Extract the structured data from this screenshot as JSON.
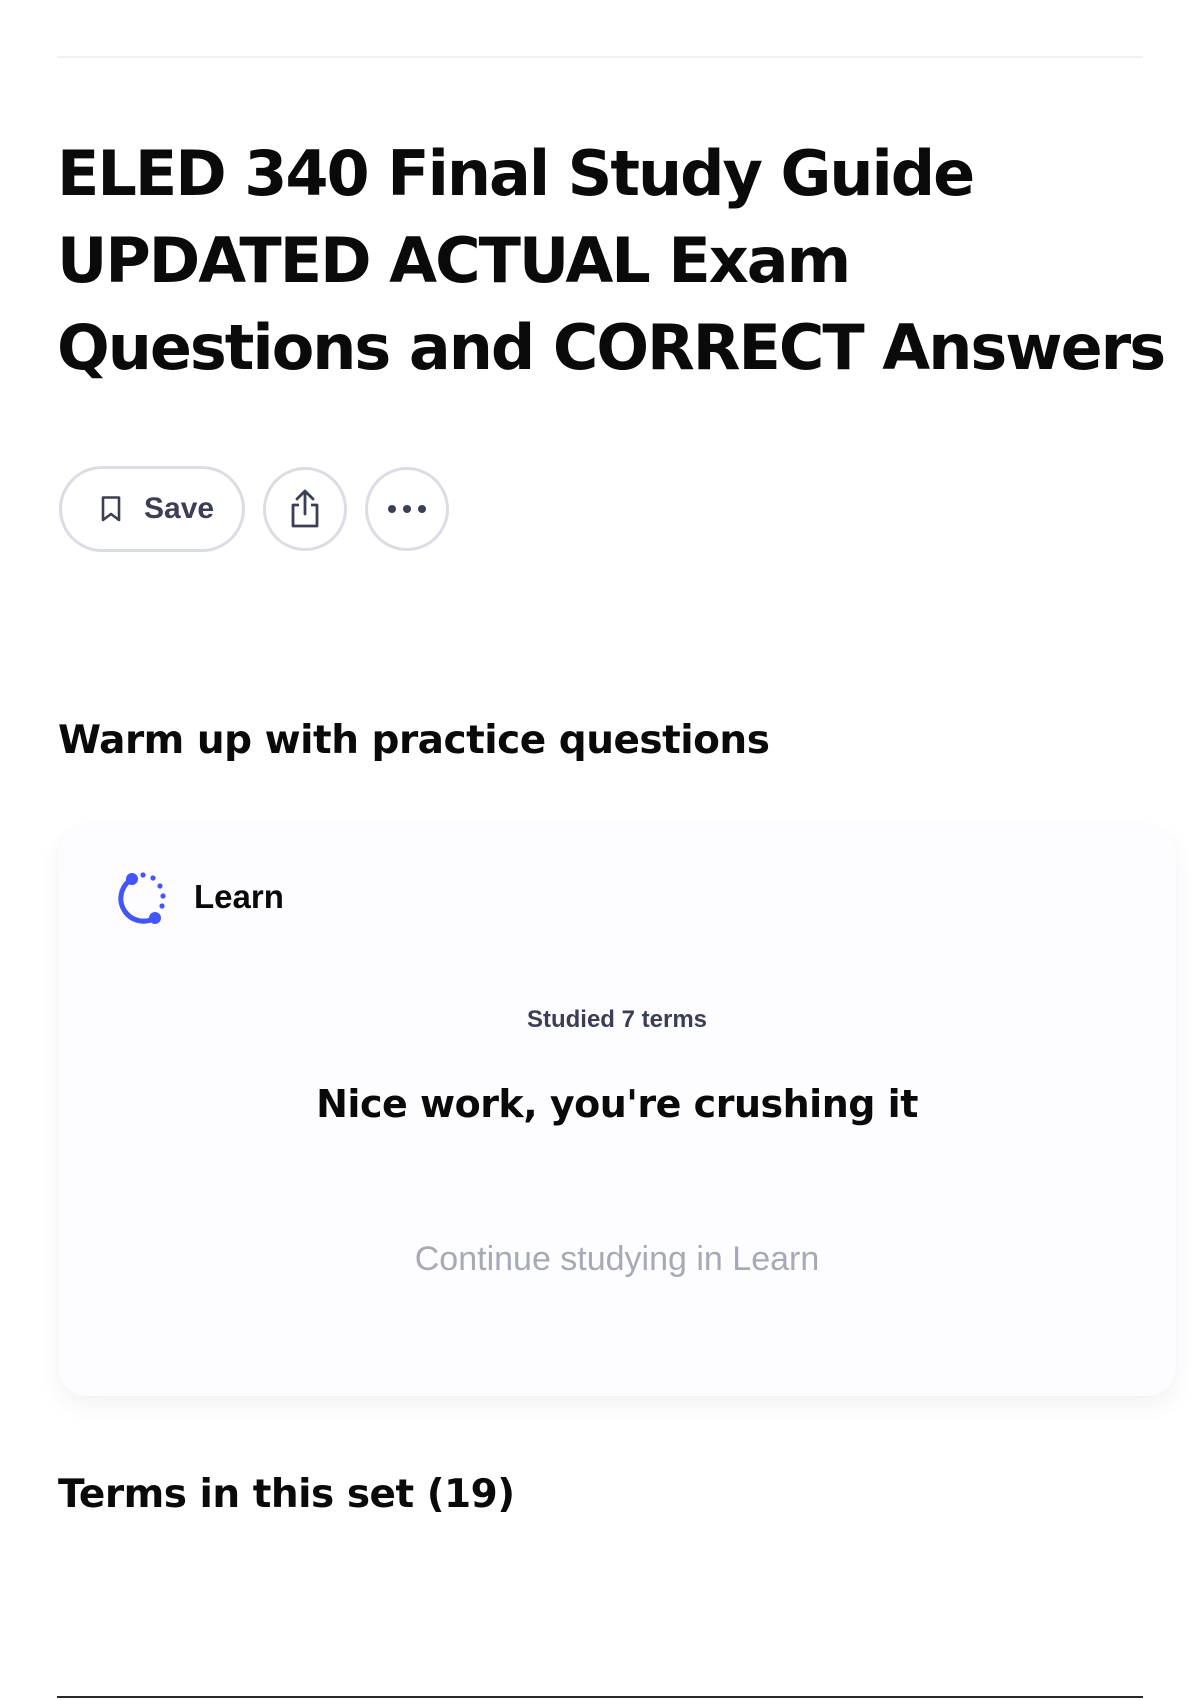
{
  "set": {
    "title_lines": [
      "ELED 340 Final Study Guide",
      "UPDATED ACTUAL Exam",
      "Questions and CORRECT Answers"
    ]
  },
  "actions": {
    "save_label": "Save",
    "save_icon": "bookmark-icon",
    "share_icon": "share-icon",
    "more_icon": "more-options-icon"
  },
  "warmup": {
    "heading": "Warm up with practice questions",
    "card": {
      "mode_label": "Learn",
      "mode_icon": "learn-icon",
      "studied_text": "Studied 7 terms",
      "message": "Nice work, you're crushing it",
      "continue_label": "Continue studying in Learn"
    }
  },
  "terms": {
    "heading": "Terms in this set (19)"
  },
  "colors": {
    "text_primary": "#0a0a0a",
    "text_secondary": "#3b3f55",
    "text_muted": "#a6a9b6",
    "learn_accent": "#4255ff",
    "border": "#dbdde4"
  }
}
